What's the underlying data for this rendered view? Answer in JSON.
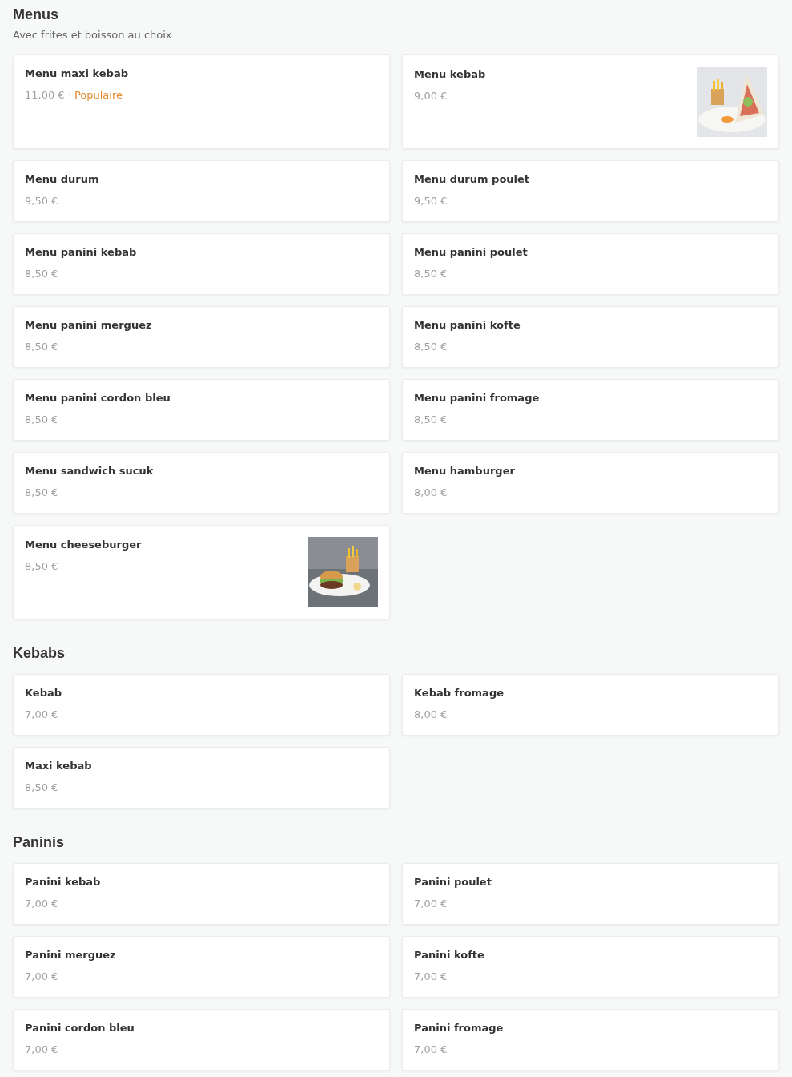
{
  "sections": [
    {
      "title": "Menus",
      "subtitle": "Avec frites et boisson au choix",
      "items": [
        {
          "name": "Menu maxi kebab",
          "price": "11,00 €",
          "tag": "· Populaire"
        },
        {
          "name": "Menu kebab",
          "price": "9,00 €"
        },
        {
          "name": "Menu durum",
          "price": "9,50 €"
        },
        {
          "name": "Menu durum poulet",
          "price": "9,50 €"
        },
        {
          "name": "Menu panini kebab",
          "price": "8,50 €"
        },
        {
          "name": "Menu panini poulet",
          "price": "8,50 €"
        },
        {
          "name": "Menu panini merguez",
          "price": "8,50 €"
        },
        {
          "name": "Menu panini kofte",
          "price": "8,50 €"
        },
        {
          "name": "Menu panini cordon bleu",
          "price": "8,50 €"
        },
        {
          "name": "Menu panini fromage",
          "price": "8,50 €"
        },
        {
          "name": "Menu sandwich sucuk",
          "price": "8,50 €"
        },
        {
          "name": "Menu hamburger",
          "price": "8,00 €"
        },
        {
          "name": "Menu cheeseburger",
          "price": "8,50 €"
        }
      ]
    },
    {
      "title": "Kebabs",
      "items": [
        {
          "name": "Kebab",
          "price": "7,00 €"
        },
        {
          "name": "Kebab fromage",
          "price": "8,00 €"
        },
        {
          "name": "Maxi kebab",
          "price": "8,50 €"
        }
      ]
    },
    {
      "title": "Paninis",
      "items": [
        {
          "name": "Panini kebab",
          "price": "7,00 €"
        },
        {
          "name": "Panini poulet",
          "price": "7,00 €"
        },
        {
          "name": "Panini merguez",
          "price": "7,00 €"
        },
        {
          "name": "Panini kofte",
          "price": "7,00 €"
        },
        {
          "name": "Panini cordon bleu",
          "price": "7,00 €"
        },
        {
          "name": "Panini fromage",
          "price": "7,00 €"
        }
      ]
    }
  ]
}
